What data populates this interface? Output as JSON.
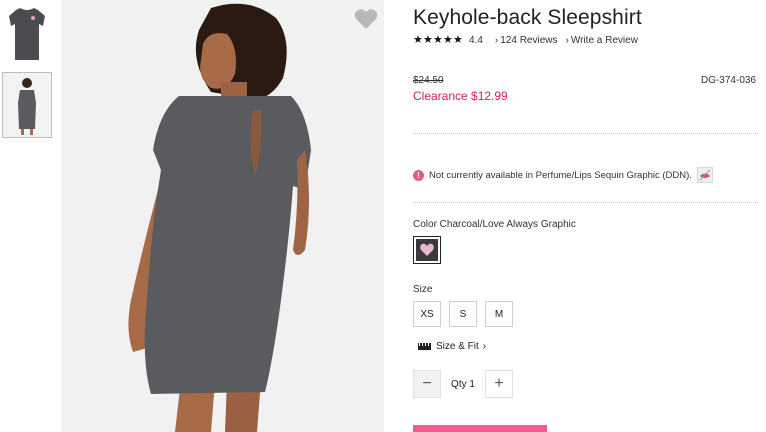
{
  "thumbnails": [
    {
      "name": "thumbnail-front-flat"
    },
    {
      "name": "thumbnail-model-back",
      "selected": true
    }
  ],
  "hero": {
    "favorite_icon": "heart-icon"
  },
  "product": {
    "title": "Keyhole-back Sleepshirt",
    "rating": "4.4",
    "stars": [
      "★",
      "★",
      "★",
      "★",
      "★"
    ],
    "reviews_link": "124 Reviews",
    "write_review": "Write a Review",
    "chevron": "›",
    "original_price": "$24.50",
    "sale_price": "Clearance $12.99",
    "sku": "DG-374-036",
    "availability_notice": "Not currently available in Perfume/Lips Sequin Graphic (DDN).",
    "info_icon": "!"
  },
  "color": {
    "label": "Color Charcoal/Love Always Graphic",
    "selected_swatch": "charcoal"
  },
  "size": {
    "label": "Size",
    "options": [
      "XS",
      "S",
      "M"
    ],
    "fit_link": "Size & Fit",
    "fit_chevron": "›"
  },
  "quantity": {
    "label": "Qty 1",
    "minus": "−",
    "plus": "+"
  },
  "colors": {
    "accent": "#d0205f",
    "button": "#ef5d8f",
    "garment": "#5a5b5f"
  }
}
